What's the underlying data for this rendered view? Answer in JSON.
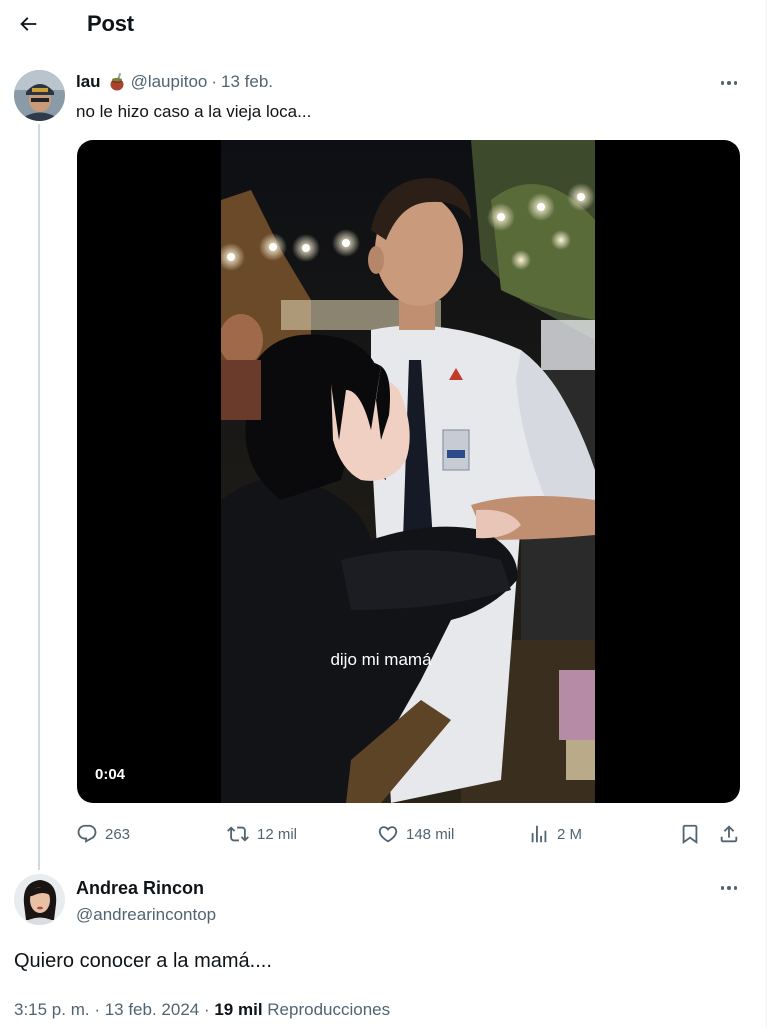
{
  "header": {
    "back_icon": "arrow-left-icon",
    "title": "Post"
  },
  "post": {
    "author_name": "lau",
    "author_emoji_icon": "mate-cup-icon",
    "author_handle": "@laupitoo",
    "separator": "·",
    "date": "13 feb.",
    "text": "no le hizo caso a la vieja loca...",
    "video": {
      "caption": "dijo mi mamá",
      "timestamp": "0:04"
    },
    "actions": {
      "replies": "263",
      "reposts": "12 mil",
      "likes": "148 mil",
      "views": "2 M"
    }
  },
  "reply": {
    "author_name": "Andrea Rincon",
    "author_handle": "@andrearincontop",
    "text": "Quiero conocer a la mamá....",
    "meta": {
      "time_date": "3:15 p. m. · 13 feb. 2024 · ",
      "views_count": "19 mil",
      "views_label": " Reproducciones"
    }
  },
  "colors": {
    "text_primary": "#0f1419",
    "text_secondary": "#536471",
    "thread_line": "#cfd9de",
    "media_bg": "#000000"
  }
}
